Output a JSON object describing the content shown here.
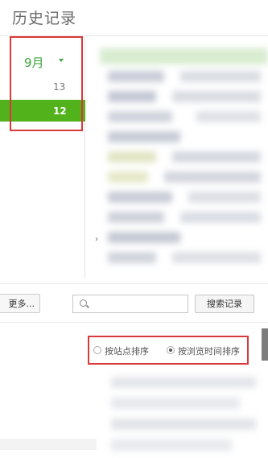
{
  "page": {
    "title": "历史记录"
  },
  "calendar": {
    "month_label": "9月",
    "days": [
      "13",
      "12"
    ],
    "selected_day": "12"
  },
  "toolbar": {
    "more_button": "更多...",
    "search_placeholder": "",
    "search_button": "搜索记录"
  },
  "sort": {
    "options": [
      "按站点排序",
      "按浏览时间排序"
    ],
    "selected": "按浏览时间排序"
  },
  "colors": {
    "accent_green": "#52b21c",
    "month_green": "#3aa63a",
    "highlight_red": "#d9393a"
  },
  "icons": [
    "chevron-down-icon",
    "search-icon",
    "chevron-right-icon"
  ]
}
